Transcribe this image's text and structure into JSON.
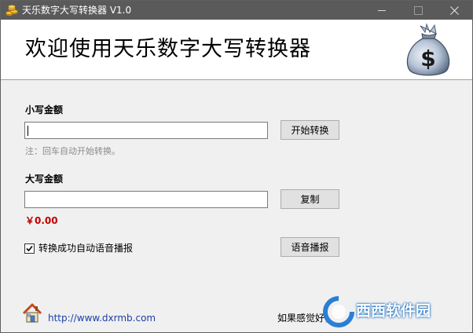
{
  "window": {
    "title": "天乐数字大写转换器 V1.0",
    "icon": "coin-stack-icon"
  },
  "header": {
    "title": "欢迎使用天乐数字大写转换器",
    "image": "money-bag-icon"
  },
  "small_amount": {
    "label": "小写金额",
    "value": "",
    "note": "注：回车自动开始转换。",
    "convert_label": "开始转换"
  },
  "big_amount": {
    "label": "大写金额",
    "value": "",
    "copy_label": "复制",
    "amount_display": "￥0.00"
  },
  "voice": {
    "checkbox_label": "转换成功自动语音播报",
    "checked": true,
    "button_label": "语音播报"
  },
  "footer": {
    "link": "http://www.dxrmb.com",
    "message": "如果感觉好，",
    "home_icon": "home-icon"
  },
  "watermark": {
    "text": "西西软件园"
  },
  "colors": {
    "titlebar": "#5a5a5a",
    "amount": "#c00000",
    "link": "#1a3fa8"
  }
}
